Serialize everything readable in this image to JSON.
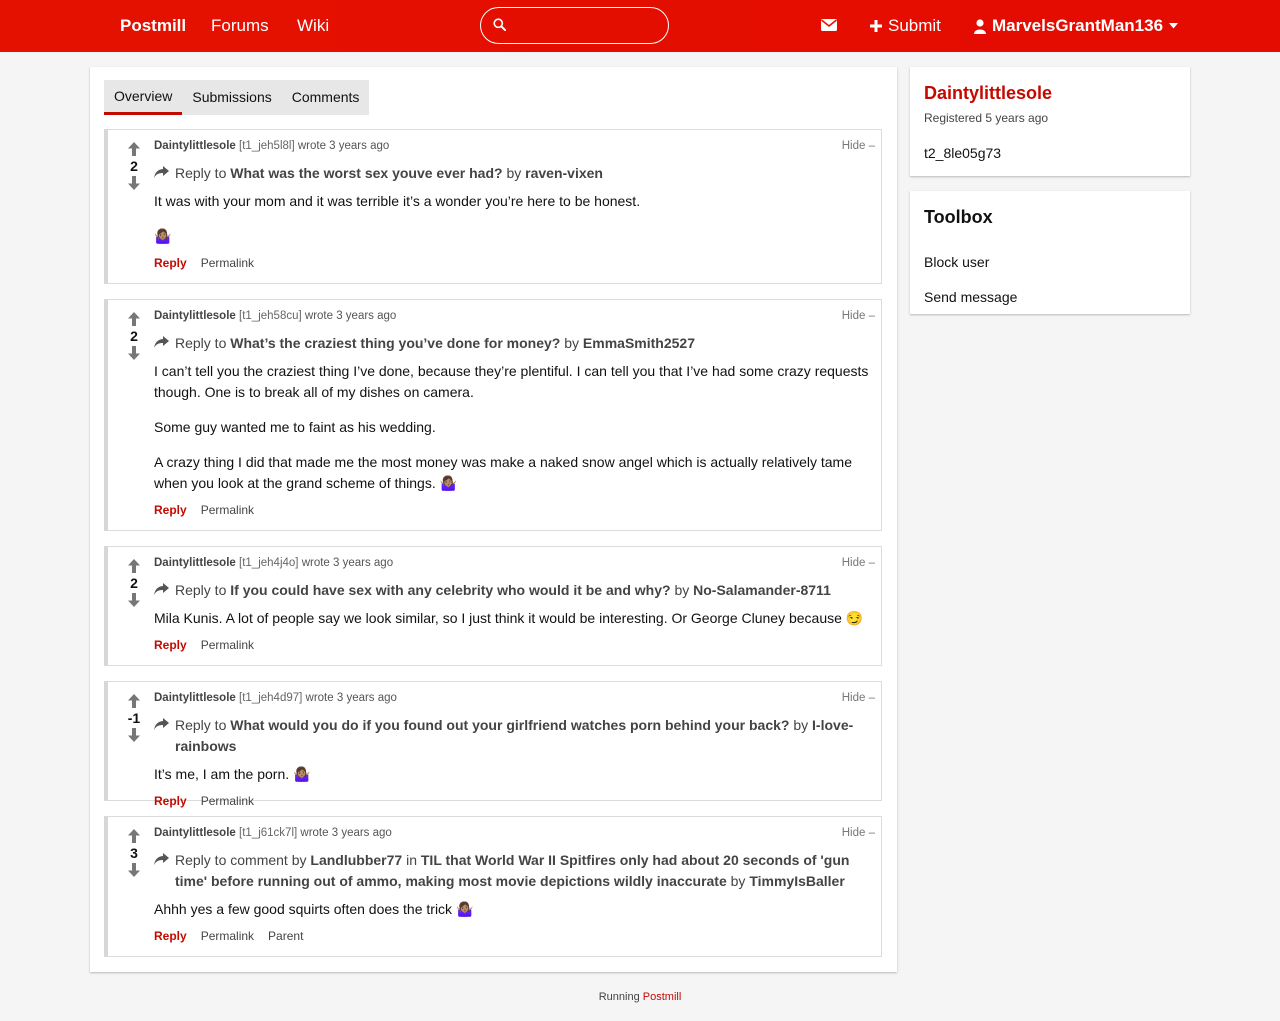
{
  "nav": {
    "brand": "Postmill",
    "forums": "Forums",
    "wiki": "Wiki",
    "search_value": "",
    "submit": "Submit",
    "username": "MarvelsGrantMan136",
    "color": "#e41100"
  },
  "tabs": [
    "Overview",
    "Submissions",
    "Comments"
  ],
  "active_tab": "Overview",
  "comments": [
    {
      "score": "2",
      "author": "Daintylittlesole",
      "id": "[t1_jeh5l8l]",
      "wrote": "wrote 3 years ago",
      "hide": "Hide –",
      "reply_prefix": "Reply to",
      "reply_title": "What was the worst sex youve ever had?",
      "by": "by",
      "reply_author": "raven-vixen",
      "paragraphs": [
        "It was with your mom and it was terrible it’s a wonder you’re here to be honest.",
        "🤷🏽‍♀️"
      ],
      "reply": "Reply",
      "permalink": "Permalink"
    },
    {
      "score": "2",
      "author": "Daintylittlesole",
      "id": "[t1_jeh58cu]",
      "wrote": "wrote 3 years ago",
      "hide": "Hide –",
      "reply_prefix": "Reply to",
      "reply_title": "What’s the craziest thing you’ve done for money?",
      "by": "by",
      "reply_author": "EmmaSmith2527",
      "paragraphs": [
        "I can’t tell you the craziest thing I’ve done, because they’re plentiful. I can tell you that I’ve had some crazy requests though. One is to break all of my dishes on camera.",
        "Some guy wanted me to faint as his wedding.",
        "A crazy thing I did that made me the most money was make a naked snow angel which is actually relatively tame when you look at the grand scheme of things. 🤷🏽‍♀️"
      ],
      "reply": "Reply",
      "permalink": "Permalink"
    },
    {
      "score": "2",
      "author": "Daintylittlesole",
      "id": "[t1_jeh4j4o]",
      "wrote": "wrote 3 years ago",
      "hide": "Hide –",
      "reply_prefix": "Reply to",
      "reply_title": "If you could have sex with any celebrity who would it be and why?",
      "by": "by",
      "reply_author": "No-Salamander-8711",
      "paragraphs": [
        "Mila Kunis. A lot of people say we look similar, so I just think it would be interesting. Or George Cluney because 😏"
      ],
      "reply": "Reply",
      "permalink": "Permalink"
    },
    {
      "score": "-1",
      "author": "Daintylittlesole",
      "id": "[t1_jeh4d97]",
      "wrote": "wrote 3 years ago",
      "hide": "Hide –",
      "reply_prefix": "Reply to",
      "reply_title": "What would you do if you found out your girlfriend watches porn behind your back?",
      "by": "by",
      "reply_author": "I-love-rainbows",
      "paragraphs": [
        "It’s me, I am the porn. 🤷🏽‍♀️"
      ],
      "reply": "Reply",
      "permalink": "Permalink"
    },
    {
      "score": "3",
      "author": "Daintylittlesole",
      "id": "[t1_j61ck7l]",
      "wrote": "wrote 3 years ago",
      "hide": "Hide –",
      "reply_prefix": "Reply to comment by",
      "parent_author": "Landlubber77",
      "in": "in",
      "reply_title": "TIL that World War II Spitfires only had about 20 seconds of 'gun time' before running out of ammo, making most movie depictions wildly inaccurate",
      "by": "by",
      "reply_author": "TimmyIsBaller",
      "paragraphs": [
        "Ahhh yes a few good squirts often does the trick 🤷🏽‍♀️"
      ],
      "reply": "Reply",
      "permalink": "Permalink",
      "parent": "Parent"
    }
  ],
  "sidebar": {
    "username": "Daintylittlesole",
    "registered": "Registered 5 years ago",
    "user_id": "t2_8le05g73",
    "toolbox_title": "Toolbox",
    "block_user": "Block user",
    "send_message": "Send message"
  },
  "footer": {
    "running": "Running",
    "postmill": "Postmill"
  }
}
